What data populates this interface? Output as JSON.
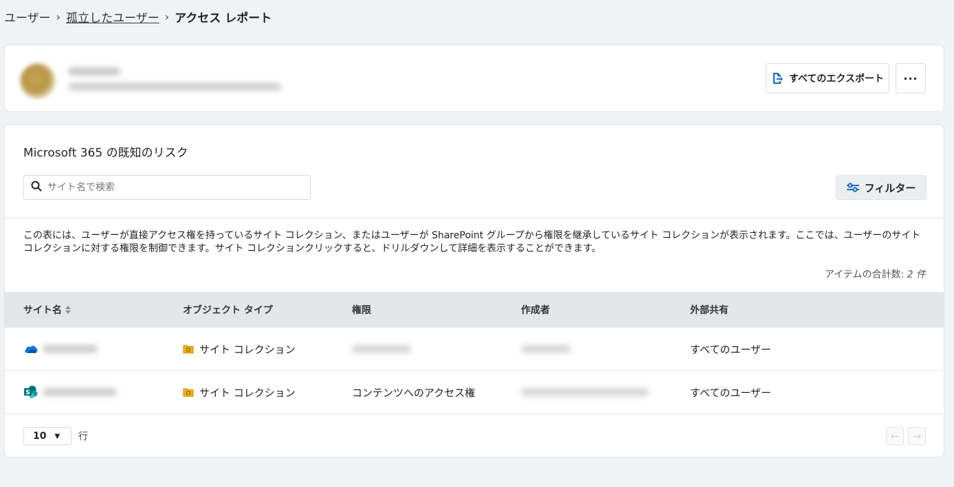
{
  "breadcrumb": {
    "items": [
      "ユーザー",
      "孤立したユーザー",
      "アクセス レポート"
    ]
  },
  "user_card": {
    "export_label": "すべてのエクスポート",
    "more_label": "···"
  },
  "section": {
    "title": "Microsoft 365 の既知のリスク",
    "search_placeholder": "サイト名で検索",
    "filter_label": "フィルター",
    "description": "この表には、ユーザーが直接アクセス権を持っているサイト コレクション、またはユーザーが SharePoint グループから権限を継承しているサイト コレクションが表示されます。ここでは、ユーザーのサイト コレクションに対する権限を制御できます。サイト コレクションクリックすると、ドリルダウンして詳細を表示することができます。",
    "total_label": "アイテムの合計数:",
    "total_count": "2 件"
  },
  "table": {
    "columns": [
      "サイト名",
      "オブジェクト タイプ",
      "権限",
      "作成者",
      "外部共有"
    ],
    "rows": [
      {
        "site_icon": "onedrive-icon",
        "object_type": "サイト コレクション",
        "permission": "",
        "external_sharing": "すべてのユーザー"
      },
      {
        "site_icon": "sharepoint-icon",
        "object_type": "サイト コレクション",
        "permission": "コンテンツへのアクセス権",
        "external_sharing": "すべてのユーザー"
      }
    ]
  },
  "footer": {
    "page_size": "10",
    "rows_label": "行",
    "prev_label": "←",
    "next_label": "→"
  },
  "colors": {
    "background": "#f1f2f4",
    "accent_blue": "#1565c0",
    "header_bg": "#e5e6e9"
  }
}
